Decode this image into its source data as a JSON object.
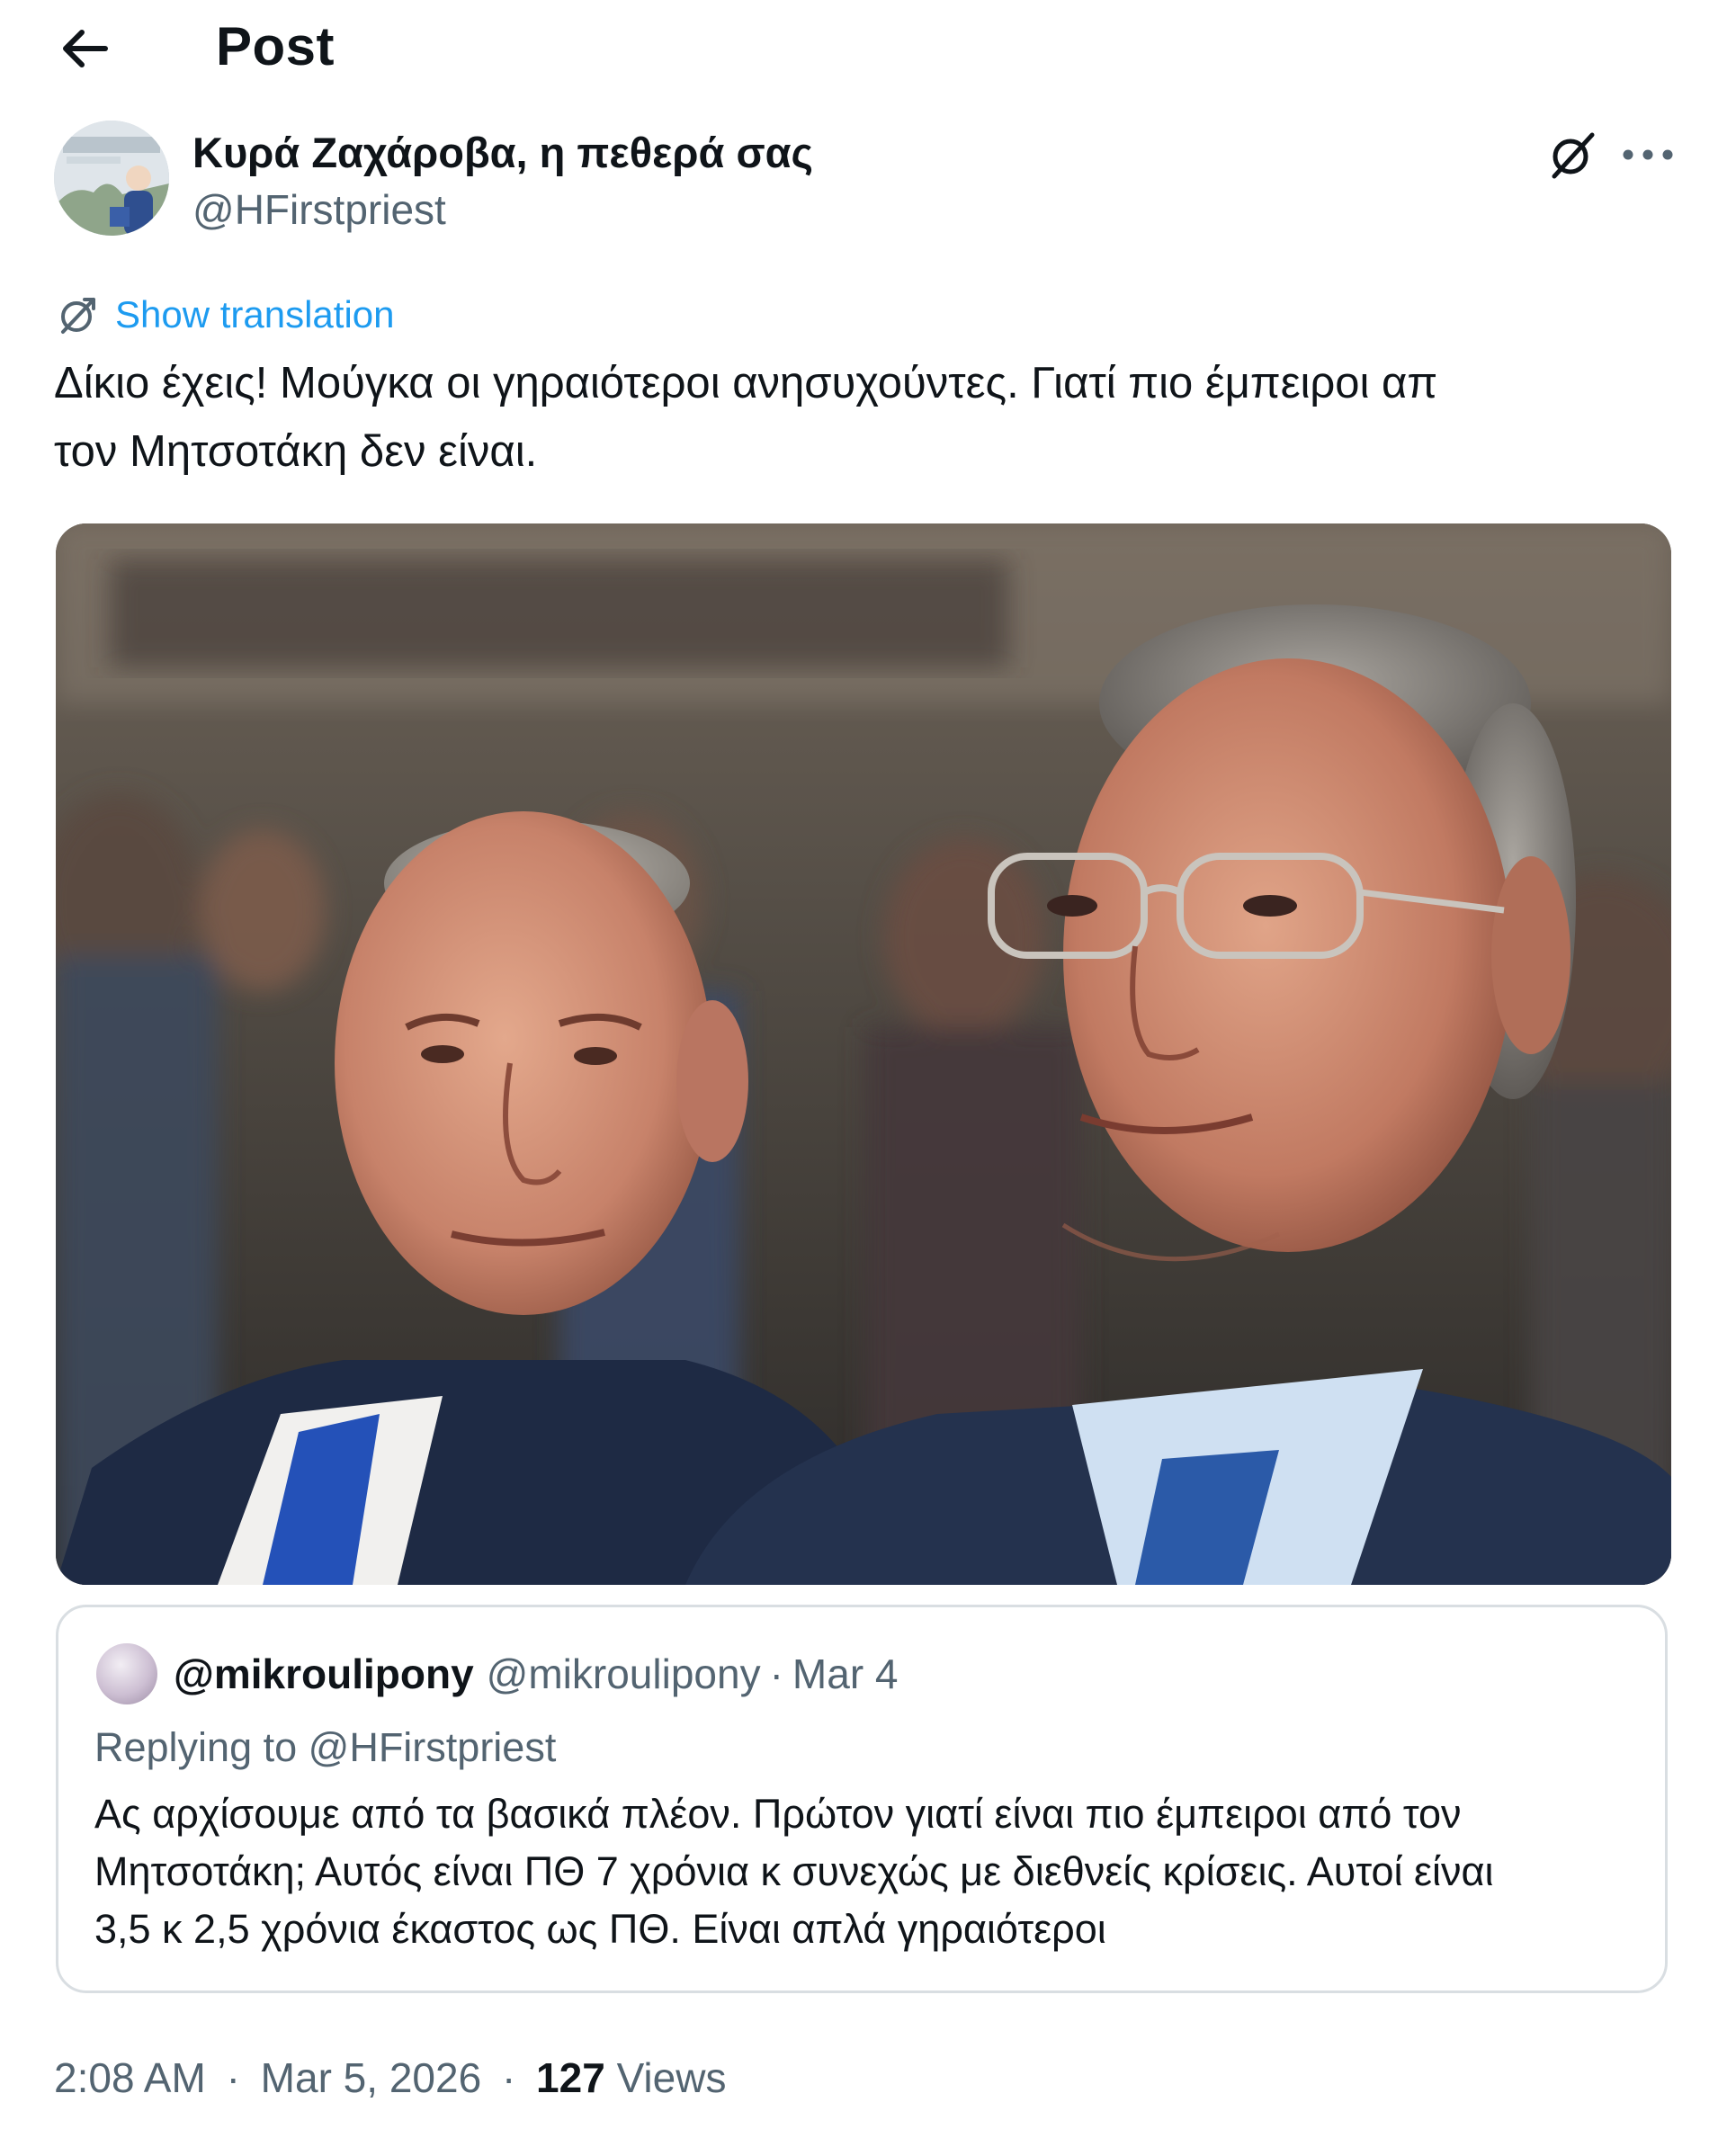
{
  "header": {
    "title": "Post",
    "back_icon": "arrow-left-icon"
  },
  "author": {
    "name": "Κυρά Ζαχάροβα, η πεθερά σας",
    "handle": "@HFirstpriest",
    "avatar_icon": "avatar-icon",
    "grok_icon": "grok-icon",
    "more_icon": "more-horizontal-icon"
  },
  "translation": {
    "label": "Show translation",
    "icon": "translate-icon"
  },
  "tweet": {
    "line1": "Δίκιο έχεις! Μούγκα οι γηραιότεροι ανησυχούντες. Γιατί πιο έμπειροι απ",
    "line2": "τον Μητσοτάκη δεν είναι."
  },
  "quote": {
    "name": "@mikroulipony",
    "handle": "@mikroulipony",
    "separator": "·",
    "date": "Mar 4",
    "replying_to": "Replying to @HFirstpriest",
    "text_line1": "Ας αρχίσουμε από τα βασικά πλέον. Πρώτον γιατί είναι πιο έμπειροι από τον",
    "text_line2": "Μητσοτάκη; Αυτός είναι ΠΘ 7 χρόνια κ συνεχώς με διεθνείς κρίσεις. Αυτοί είναι",
    "text_line3": "3,5 κ 2,5 χρόνια έκαστος ως ΠΘ. Είναι απλά γηραιότεροι"
  },
  "meta": {
    "time": "2:08 AM",
    "date": "Mar 5, 2026",
    "separator": "·",
    "views_count": "127",
    "views_label": "Views"
  },
  "colors": {
    "accent": "#1d9bf0",
    "text": "#0f1419",
    "secondary": "#536471",
    "border": "#d9dee2"
  }
}
